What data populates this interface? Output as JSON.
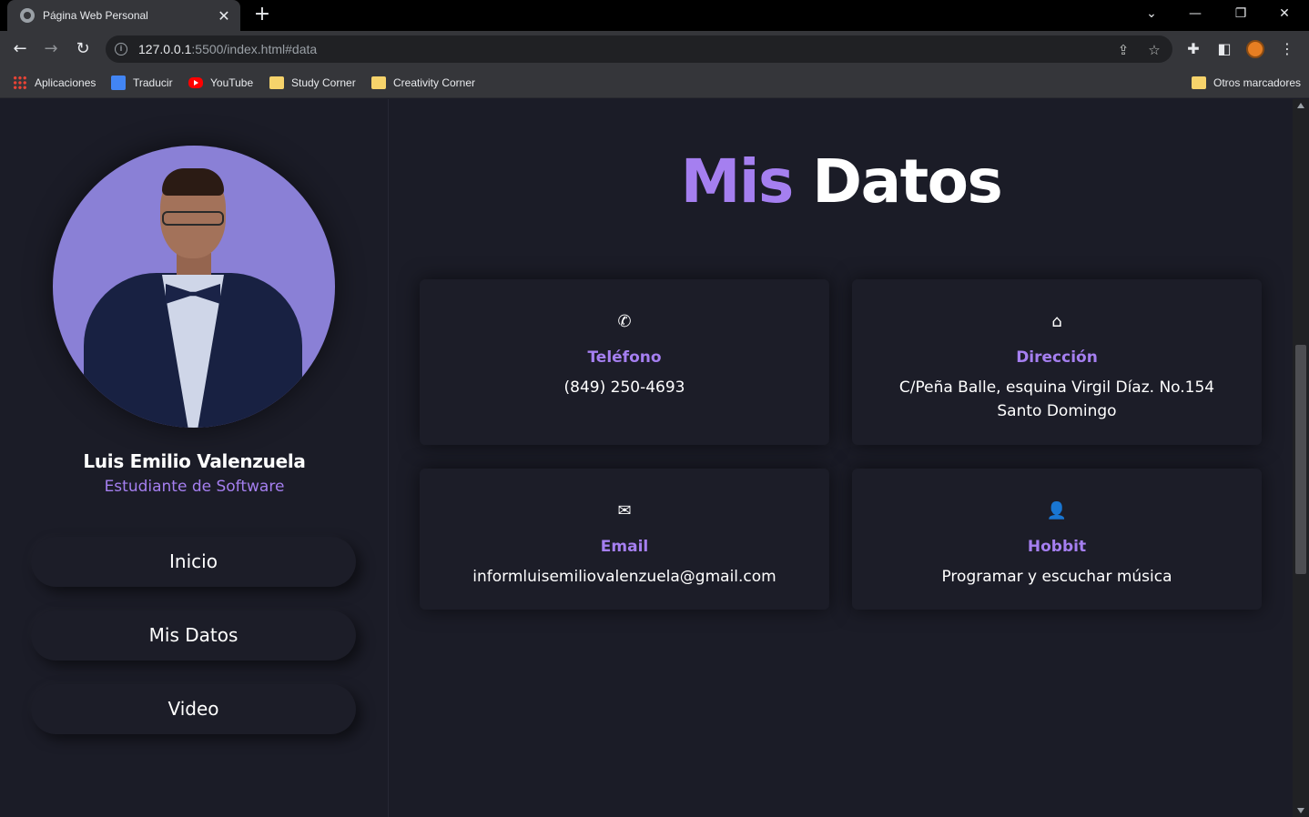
{
  "browser": {
    "tab_title": "Página Web Personal",
    "tab_close": "✕",
    "new_tab": "+",
    "url_host": "127.0.0.1",
    "url_rest": ":5500/index.html#data",
    "window_controls": [
      "⌄",
      "—",
      "❐",
      "✕"
    ]
  },
  "bookmarks": {
    "items": [
      {
        "label": "Aplicaciones",
        "icon": "apps-icon"
      },
      {
        "label": "Traducir",
        "icon": "translate-icon"
      },
      {
        "label": "YouTube",
        "icon": "youtube-icon"
      },
      {
        "label": "Study Corner",
        "icon": "folder-icon"
      },
      {
        "label": "Creativity Corner",
        "icon": "folder-icon"
      }
    ],
    "other": "Otros marcadores"
  },
  "profile": {
    "name": "Luis Emilio Valenzuela",
    "role": "Estudiante de Software"
  },
  "nav": {
    "items": [
      "Inicio",
      "Mis Datos",
      "Video"
    ]
  },
  "main": {
    "heading_word1": "Mis",
    "heading_word2": "Datos",
    "cards": [
      {
        "icon": "phone-icon",
        "label": "Teléfono",
        "value": "(849) 250-4693"
      },
      {
        "icon": "home-icon",
        "label": "Dirección",
        "value_line1": "C/Peña Balle, esquina Virgil Díaz. No.154",
        "value_line2": "Santo Domingo"
      },
      {
        "icon": "envelope-icon",
        "label": "Email",
        "value": "informluisemiliovalenzuela@gmail.com"
      },
      {
        "icon": "user-icon",
        "label": "Hobbit",
        "value": "Programar y escuchar música"
      }
    ]
  },
  "colors": {
    "accent": "#a57ff0",
    "background": "#1b1c27",
    "card": "#1c1d28"
  }
}
